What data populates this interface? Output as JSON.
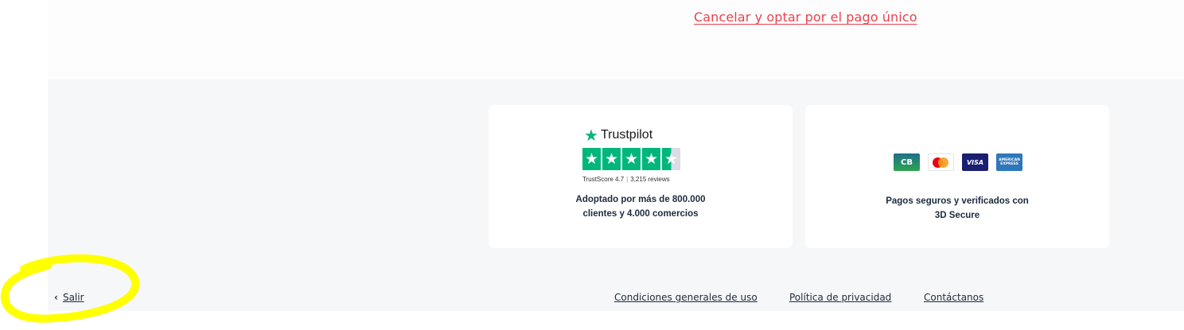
{
  "cancel_link": "Cancelar y optar por el pago único",
  "trustpilot": {
    "brand": "Trustpilot",
    "star_icon": "trustpilot-star-icon",
    "rating_stars": 4.5,
    "score_text": "TrustScore 4.7",
    "reviews_text": "3,215 reviews",
    "line1": "Adoptado por más de 800.000",
    "line2": "clientes y 4.000 comercios"
  },
  "payments": {
    "icons": [
      "cb-card-icon",
      "mastercard-icon",
      "visa-icon",
      "american-express-icon"
    ],
    "cb_text": "CB",
    "visa_text": "VISA",
    "amex_text": "AMERICAN EXPRESS",
    "line1": "Pagos seguros y verificados con",
    "line2": "3D Secure"
  },
  "exit": {
    "icon": "chevron-left-icon",
    "label": "Salir"
  },
  "footer": {
    "terms": "Condiciones generales de uso",
    "privacy": "Política de privacidad",
    "contact": "Contáctanos"
  },
  "colors": {
    "accent_link": "#e8414f",
    "trustpilot_green": "#00b67a",
    "highlight": "#ffff00",
    "text_dark": "#1d2b3d"
  }
}
